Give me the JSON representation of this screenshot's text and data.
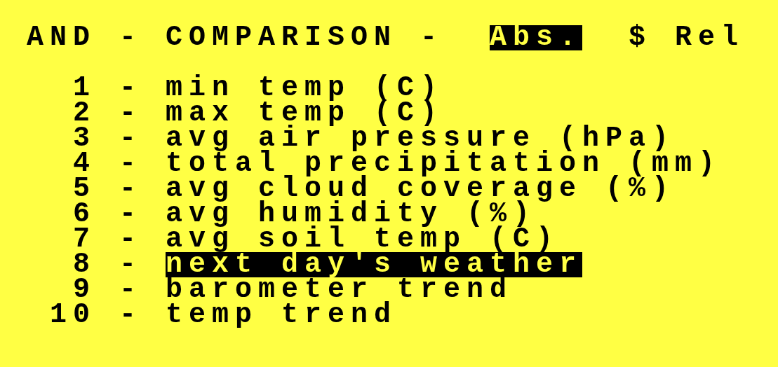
{
  "header": {
    "title": "AND - COMPARISON -",
    "modes": [
      {
        "label": "Abs.",
        "selected": true
      },
      {
        "label": "$ Rel",
        "selected": false
      }
    ]
  },
  "separator": "-",
  "options": [
    {
      "key": "1",
      "label": "min temp (C)",
      "selected": false
    },
    {
      "key": "2",
      "label": "max temp (C)",
      "selected": false
    },
    {
      "key": "3",
      "label": "avg air pressure (hPa)",
      "selected": false
    },
    {
      "key": "4",
      "label": "total precipitation (mm)",
      "selected": false
    },
    {
      "key": "5",
      "label": "avg cloud coverage (%)",
      "selected": false
    },
    {
      "key": "6",
      "label": "avg humidity (%)",
      "selected": false
    },
    {
      "key": "7",
      "label": "avg soil temp (C)",
      "selected": false
    },
    {
      "key": "8",
      "label": "next day's weather",
      "selected": true
    },
    {
      "key": "9",
      "label": "barometer trend",
      "selected": false
    },
    {
      "key": "10",
      "label": "temp trend",
      "selected": false
    }
  ]
}
